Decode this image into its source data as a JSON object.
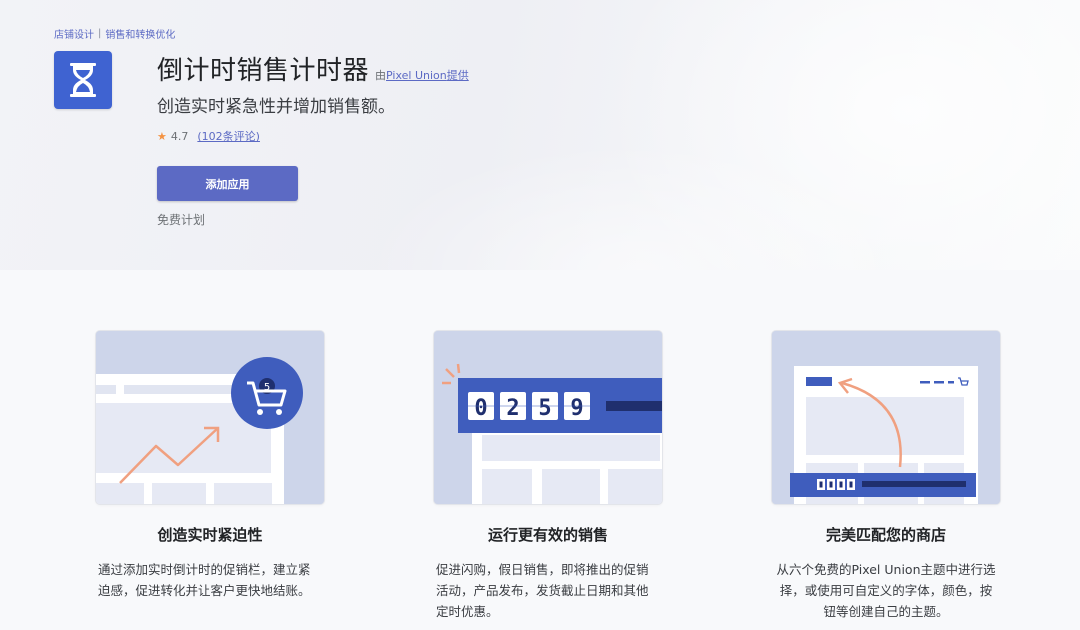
{
  "breadcrumb": {
    "items": [
      "店铺设计",
      "销售和转换优化"
    ],
    "separator": "|"
  },
  "app": {
    "title": "倒计时销售计时器",
    "by_prefix": "由",
    "developer": "Pixel Union",
    "by_suffix": "提供",
    "tagline": "创造实时紧急性并增加销售额。",
    "rating": "4.7",
    "reviews": "(102条评论)",
    "add_button": "添加应用",
    "plan": "免费计划",
    "icon": "hourglass-icon"
  },
  "cart_badge": "5",
  "timer_digits": [
    "0",
    "2",
    "5",
    "9"
  ],
  "features": [
    {
      "title": "创造实时紧迫性",
      "desc": "通过添加实时倒计时的促销栏，建立紧迫感，促进转化并让客户更快地结账。"
    },
    {
      "title": "运行更有效的销售",
      "desc": "促进闪购，假日销售，即将推出的促销活动，产品发布，发货截止日期和其他定时优惠。"
    },
    {
      "title": "完美匹配您的商店",
      "desc": "从六个免费的Pixel Union主题中进行选择，或使用可自定义的字体，颜色，按钮等创建自己的主题。"
    }
  ],
  "colors": {
    "accent": "#5c6ac4",
    "icon_bg": "#3f63d1",
    "illustration_blue": "#3f5dbd",
    "arrow_orange": "#f0a080",
    "star": "#f49342"
  }
}
